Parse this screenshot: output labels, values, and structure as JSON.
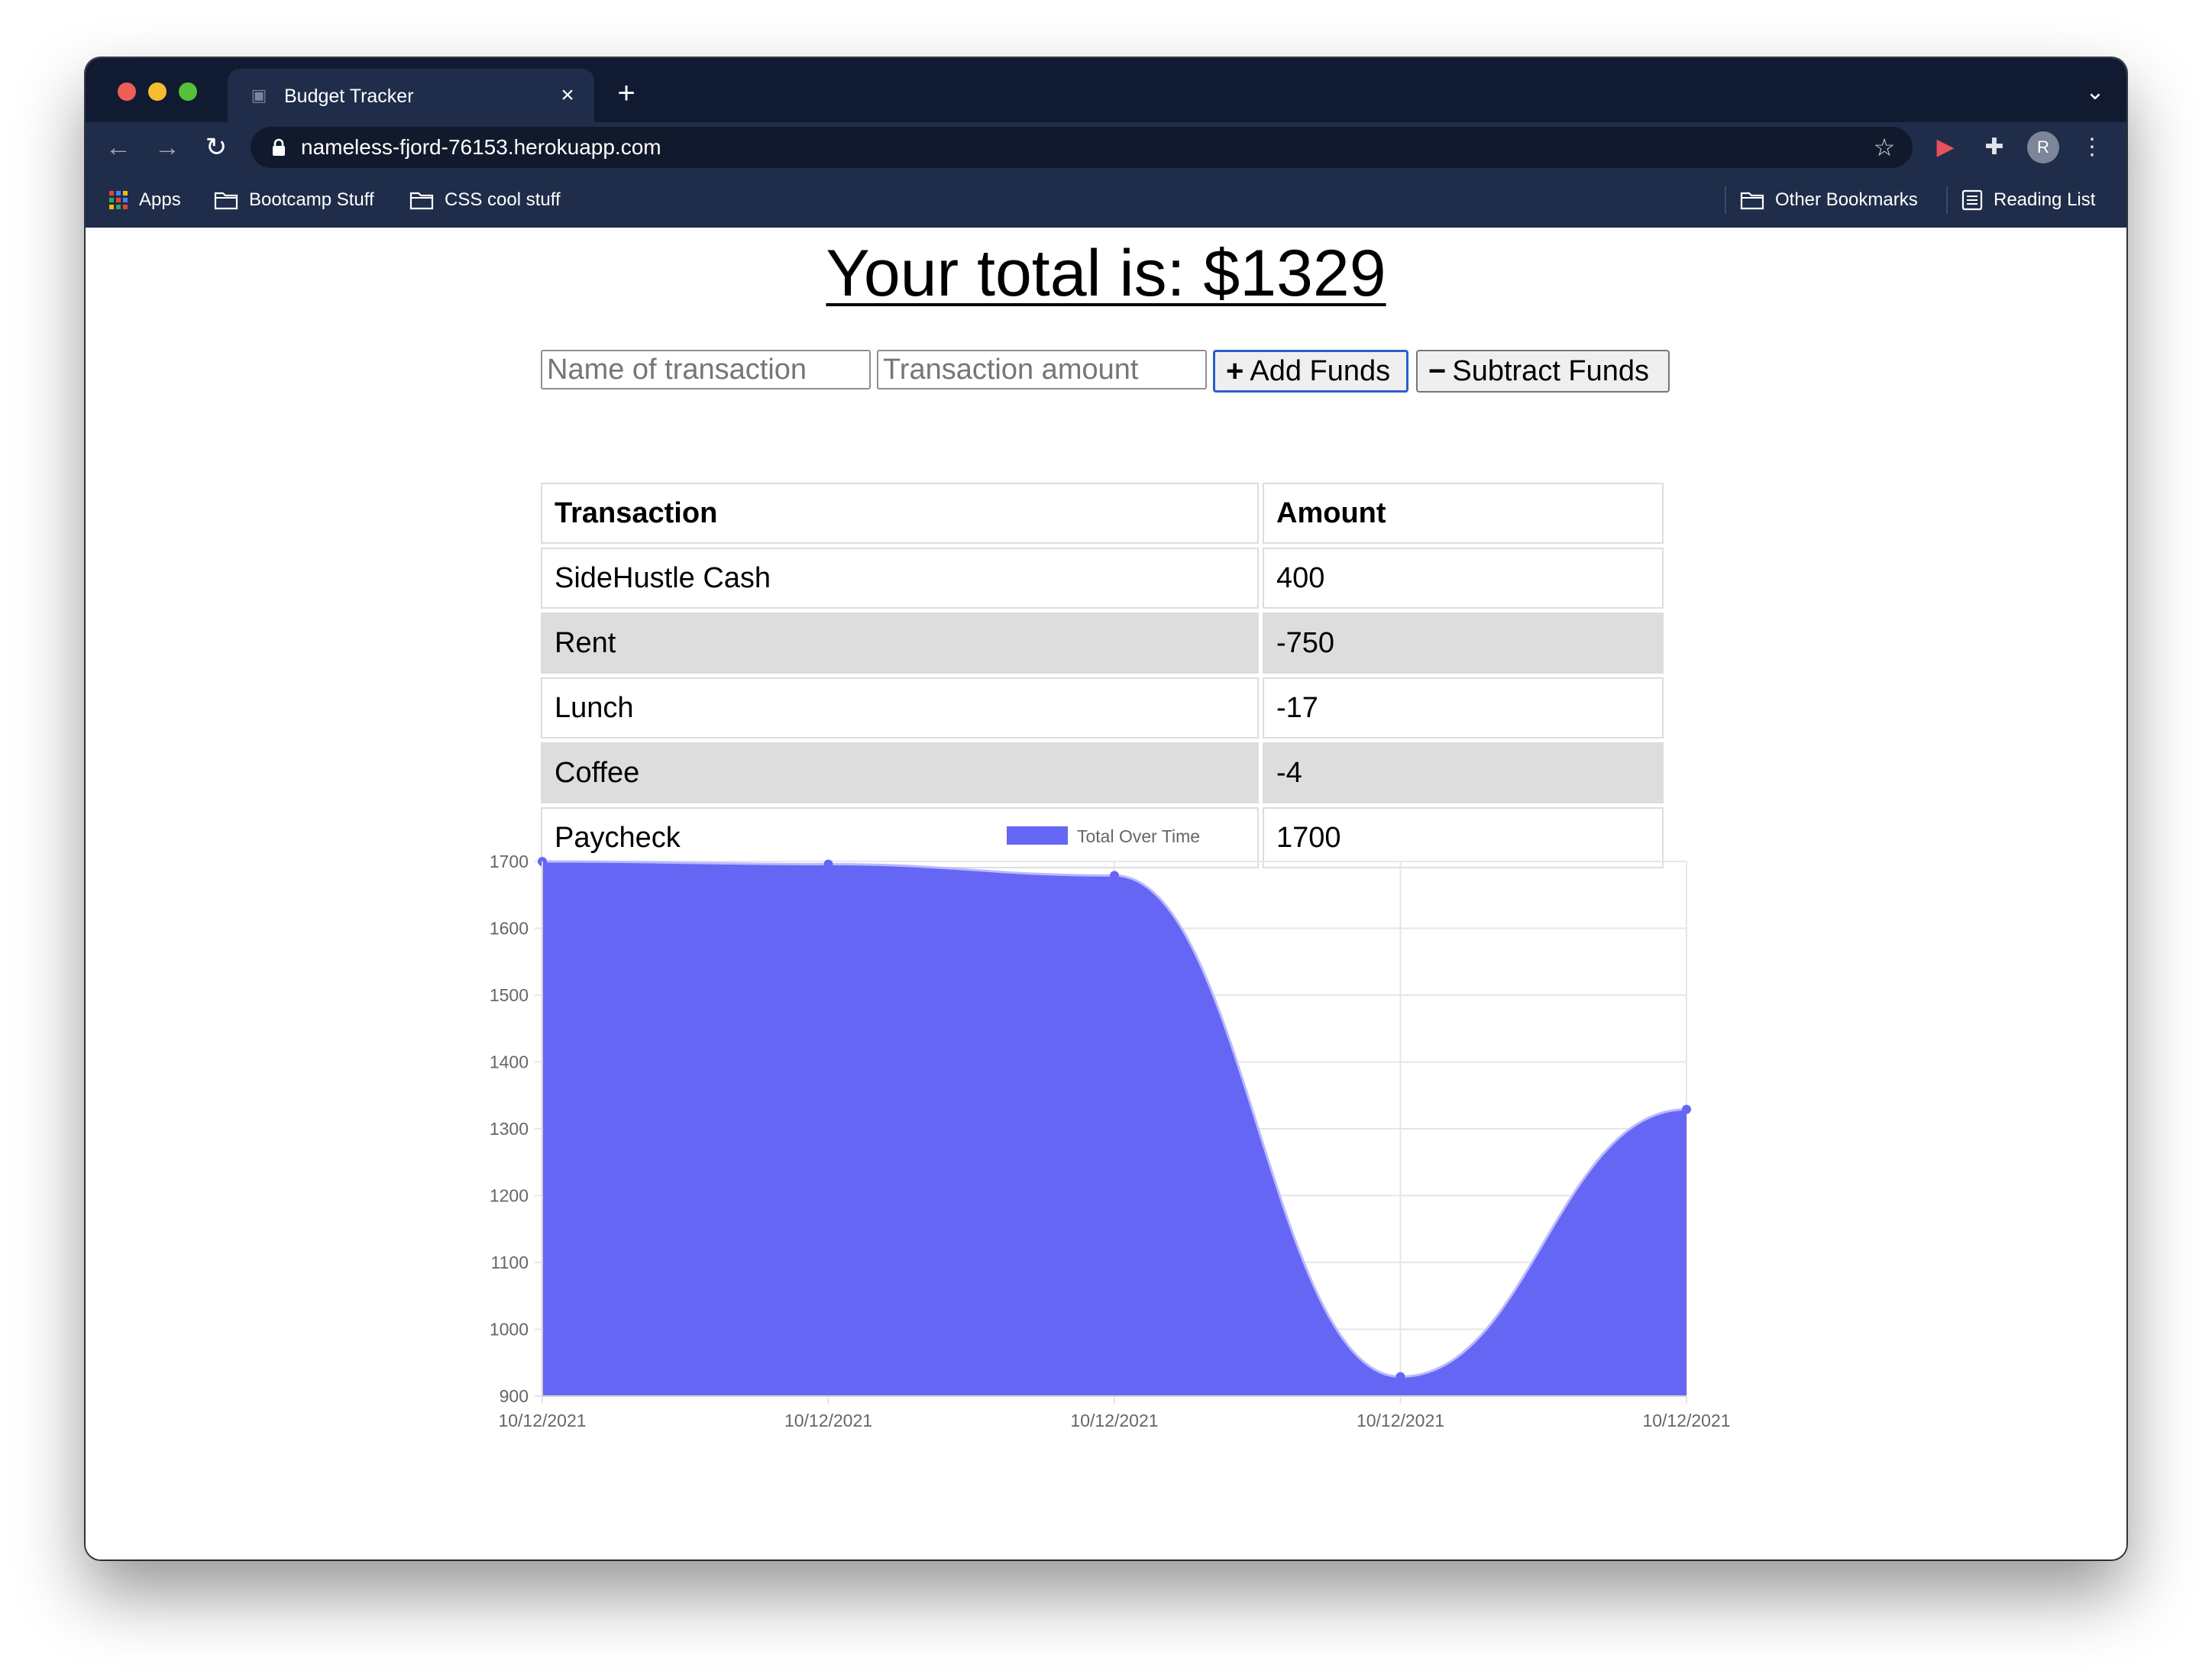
{
  "browser": {
    "tab_title": "Budget Tracker",
    "url": "nameless-fjord-76153.herokuapp.com",
    "avatar_letter": "R",
    "bookmarks": [
      {
        "label": "Apps",
        "icon": "apps-grid-icon"
      },
      {
        "label": "Bootcamp Stuff",
        "icon": "folder-icon"
      },
      {
        "label": "CSS cool stuff",
        "icon": "folder-icon"
      }
    ],
    "bookmarks_right": [
      {
        "label": "Other Bookmarks",
        "icon": "folder-icon"
      },
      {
        "label": "Reading List",
        "icon": "reading-list-icon"
      }
    ]
  },
  "page": {
    "total_text": "Your total is: $1329",
    "name_placeholder": "Name of transaction",
    "amount_placeholder": "Transaction amount",
    "add_label": "Add Funds",
    "subtract_label": "Subtract Funds"
  },
  "table": {
    "headers": [
      "Transaction",
      "Amount"
    ],
    "rows": [
      {
        "name": "SideHustle Cash",
        "amount": "400"
      },
      {
        "name": "Rent",
        "amount": "-750"
      },
      {
        "name": "Lunch",
        "amount": "-17"
      },
      {
        "name": "Coffee",
        "amount": "-4"
      },
      {
        "name": "Paycheck",
        "amount": "1700"
      }
    ]
  },
  "chart_data": {
    "type": "area",
    "x": [
      "10/12/2021",
      "10/12/2021",
      "10/12/2021",
      "10/12/2021",
      "10/12/2021"
    ],
    "series": [
      {
        "name": "Total Over Time",
        "values": [
          1700,
          1696,
          1679,
          929,
          1329
        ],
        "color": "#6666f5"
      }
    ],
    "ylim": [
      900,
      1700
    ],
    "yticks": [
      900,
      1000,
      1100,
      1200,
      1300,
      1400,
      1500,
      1600,
      1700
    ],
    "grid": true,
    "legend": "top-center"
  }
}
